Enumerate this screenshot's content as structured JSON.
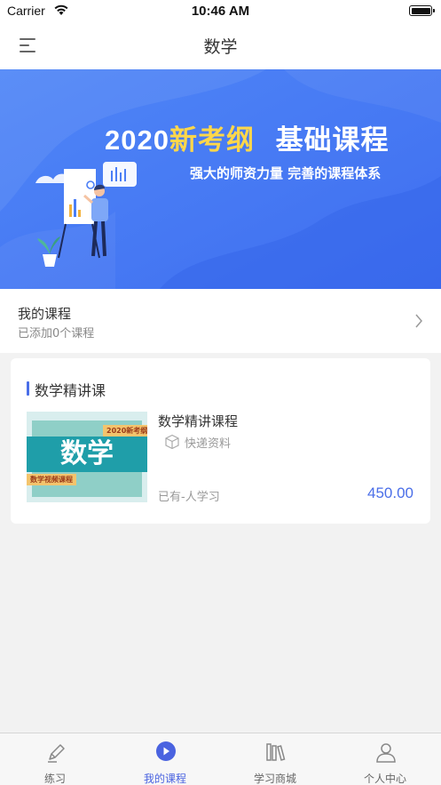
{
  "status_bar": {
    "carrier": "Carrier",
    "time": "10:46 AM"
  },
  "nav": {
    "title": "数学",
    "menu_icon": "menu-icon"
  },
  "banner": {
    "headline_year": "2020",
    "headline_highlight": "新考纲",
    "headline_rest": "基础课程",
    "subtitle": "强大的师资力量 完善的课程体系",
    "colors": {
      "background": "#4a7ef6",
      "highlight": "#ffd74a"
    }
  },
  "my_courses": {
    "label": "我的课程",
    "sublabel": "已添加0个课程"
  },
  "section": {
    "title": "数学精讲课",
    "courses": [
      {
        "thumbnail": {
          "tag_top": "2020新考纲",
          "big_text": "数学",
          "tag_bottom": "数学视频课程"
        },
        "title": "数学精讲课程",
        "delivery": "快递资料",
        "learners": "已有-人学习",
        "price": "450.00"
      }
    ]
  },
  "tabs": [
    {
      "label": "练习",
      "icon": "pencil-icon",
      "active": false
    },
    {
      "label": "我的课程",
      "icon": "play-icon",
      "active": true
    },
    {
      "label": "学习商城",
      "icon": "books-icon",
      "active": false
    },
    {
      "label": "个人中心",
      "icon": "user-icon",
      "active": false
    }
  ],
  "colors": {
    "accent": "#4a63e0",
    "price": "#4a6ee8"
  }
}
